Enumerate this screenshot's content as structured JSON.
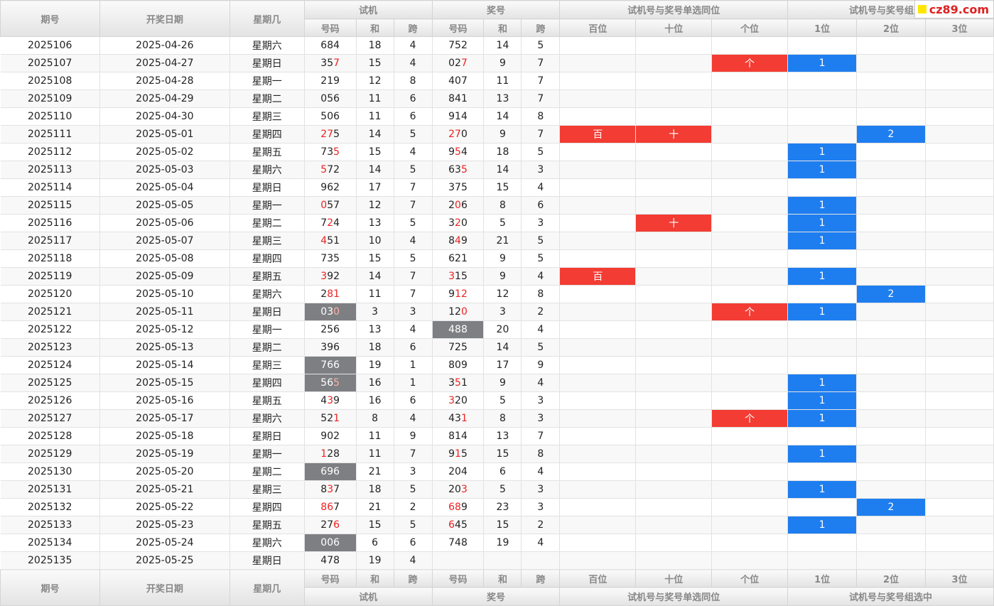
{
  "header": {
    "qihao": "期号",
    "date": "开奖日期",
    "week": "星期几",
    "shiji": "试机",
    "jianghao": "奖号",
    "same_pos": "试机号与奖号单选同位",
    "group": "试机号与奖号组选中",
    "haoma": "号码",
    "he": "和",
    "kua": "跨",
    "bai": "百位",
    "shi": "十位",
    "ge": "个位",
    "p1": "1位",
    "p2": "2位",
    "p3": "3位"
  },
  "logo": {
    "text": "cz89.com"
  },
  "colors": {
    "red_cell": "#f33c33",
    "blue_cell": "#1e7ef0",
    "gray_cell": "#7d7f82",
    "red_digit": "#ee2222"
  },
  "rows": [
    {
      "issue": "2025106",
      "date": "2025-04-26",
      "week": "星期六",
      "test": "684",
      "test_sum": "18",
      "test_span": "4",
      "win": "752",
      "win_sum": "14",
      "win_span": "5",
      "bai": "",
      "shi": "",
      "ge": "",
      "g1": "",
      "g2": "",
      "g3": "",
      "tr": [],
      "wr": [],
      "tg": false,
      "wg": false
    },
    {
      "issue": "2025107",
      "date": "2025-04-27",
      "week": "星期日",
      "test": "357",
      "test_sum": "15",
      "test_span": "4",
      "win": "027",
      "win_sum": "9",
      "win_span": "7",
      "bai": "",
      "shi": "",
      "ge": "个",
      "g1": "1",
      "g2": "",
      "g3": "",
      "tr": [
        2
      ],
      "wr": [
        2
      ],
      "tg": false,
      "wg": false
    },
    {
      "issue": "2025108",
      "date": "2025-04-28",
      "week": "星期一",
      "test": "219",
      "test_sum": "12",
      "test_span": "8",
      "win": "407",
      "win_sum": "11",
      "win_span": "7",
      "bai": "",
      "shi": "",
      "ge": "",
      "g1": "",
      "g2": "",
      "g3": "",
      "tr": [],
      "wr": [],
      "tg": false,
      "wg": false
    },
    {
      "issue": "2025109",
      "date": "2025-04-29",
      "week": "星期二",
      "test": "056",
      "test_sum": "11",
      "test_span": "6",
      "win": "841",
      "win_sum": "13",
      "win_span": "7",
      "bai": "",
      "shi": "",
      "ge": "",
      "g1": "",
      "g2": "",
      "g3": "",
      "tr": [],
      "wr": [],
      "tg": false,
      "wg": false
    },
    {
      "issue": "2025110",
      "date": "2025-04-30",
      "week": "星期三",
      "test": "506",
      "test_sum": "11",
      "test_span": "6",
      "win": "914",
      "win_sum": "14",
      "win_span": "8",
      "bai": "",
      "shi": "",
      "ge": "",
      "g1": "",
      "g2": "",
      "g3": "",
      "tr": [],
      "wr": [],
      "tg": false,
      "wg": false
    },
    {
      "issue": "2025111",
      "date": "2025-05-01",
      "week": "星期四",
      "test": "275",
      "test_sum": "14",
      "test_span": "5",
      "win": "270",
      "win_sum": "9",
      "win_span": "7",
      "bai": "百",
      "shi": "十",
      "ge": "",
      "g1": "",
      "g2": "2",
      "g3": "",
      "tr": [
        0,
        1
      ],
      "wr": [
        0,
        1
      ],
      "tg": false,
      "wg": false
    },
    {
      "issue": "2025112",
      "date": "2025-05-02",
      "week": "星期五",
      "test": "735",
      "test_sum": "15",
      "test_span": "4",
      "win": "954",
      "win_sum": "18",
      "win_span": "5",
      "bai": "",
      "shi": "",
      "ge": "",
      "g1": "1",
      "g2": "",
      "g3": "",
      "tr": [
        2
      ],
      "wr": [
        1
      ],
      "tg": false,
      "wg": false
    },
    {
      "issue": "2025113",
      "date": "2025-05-03",
      "week": "星期六",
      "test": "572",
      "test_sum": "14",
      "test_span": "5",
      "win": "635",
      "win_sum": "14",
      "win_span": "3",
      "bai": "",
      "shi": "",
      "ge": "",
      "g1": "1",
      "g2": "",
      "g3": "",
      "tr": [
        0
      ],
      "wr": [
        2
      ],
      "tg": false,
      "wg": false
    },
    {
      "issue": "2025114",
      "date": "2025-05-04",
      "week": "星期日",
      "test": "962",
      "test_sum": "17",
      "test_span": "7",
      "win": "375",
      "win_sum": "15",
      "win_span": "4",
      "bai": "",
      "shi": "",
      "ge": "",
      "g1": "",
      "g2": "",
      "g3": "",
      "tr": [],
      "wr": [],
      "tg": false,
      "wg": false
    },
    {
      "issue": "2025115",
      "date": "2025-05-05",
      "week": "星期一",
      "test": "057",
      "test_sum": "12",
      "test_span": "7",
      "win": "206",
      "win_sum": "8",
      "win_span": "6",
      "bai": "",
      "shi": "",
      "ge": "",
      "g1": "1",
      "g2": "",
      "g3": "",
      "tr": [
        0
      ],
      "wr": [
        1
      ],
      "tg": false,
      "wg": false
    },
    {
      "issue": "2025116",
      "date": "2025-05-06",
      "week": "星期二",
      "test": "724",
      "test_sum": "13",
      "test_span": "5",
      "win": "320",
      "win_sum": "5",
      "win_span": "3",
      "bai": "",
      "shi": "十",
      "ge": "",
      "g1": "1",
      "g2": "",
      "g3": "",
      "tr": [
        1
      ],
      "wr": [
        1
      ],
      "tg": false,
      "wg": false
    },
    {
      "issue": "2025117",
      "date": "2025-05-07",
      "week": "星期三",
      "test": "451",
      "test_sum": "10",
      "test_span": "4",
      "win": "849",
      "win_sum": "21",
      "win_span": "5",
      "bai": "",
      "shi": "",
      "ge": "",
      "g1": "1",
      "g2": "",
      "g3": "",
      "tr": [
        0
      ],
      "wr": [
        1
      ],
      "tg": false,
      "wg": false
    },
    {
      "issue": "2025118",
      "date": "2025-05-08",
      "week": "星期四",
      "test": "735",
      "test_sum": "15",
      "test_span": "5",
      "win": "621",
      "win_sum": "9",
      "win_span": "5",
      "bai": "",
      "shi": "",
      "ge": "",
      "g1": "",
      "g2": "",
      "g3": "",
      "tr": [],
      "wr": [],
      "tg": false,
      "wg": false
    },
    {
      "issue": "2025119",
      "date": "2025-05-09",
      "week": "星期五",
      "test": "392",
      "test_sum": "14",
      "test_span": "7",
      "win": "315",
      "win_sum": "9",
      "win_span": "4",
      "bai": "百",
      "shi": "",
      "ge": "",
      "g1": "1",
      "g2": "",
      "g3": "",
      "tr": [
        0
      ],
      "wr": [
        0
      ],
      "tg": false,
      "wg": false
    },
    {
      "issue": "2025120",
      "date": "2025-05-10",
      "week": "星期六",
      "test": "281",
      "test_sum": "11",
      "test_span": "7",
      "win": "912",
      "win_sum": "12",
      "win_span": "8",
      "bai": "",
      "shi": "",
      "ge": "",
      "g1": "",
      "g2": "2",
      "g3": "",
      "tr": [
        1,
        2
      ],
      "wr": [
        1,
        2
      ],
      "tg": false,
      "wg": false
    },
    {
      "issue": "2025121",
      "date": "2025-05-11",
      "week": "星期日",
      "test": "030",
      "test_sum": "3",
      "test_span": "3",
      "win": "120",
      "win_sum": "3",
      "win_span": "2",
      "bai": "",
      "shi": "",
      "ge": "个",
      "g1": "1",
      "g2": "",
      "g3": "",
      "tr": [
        2
      ],
      "wr": [
        2
      ],
      "tg": true,
      "wg": false
    },
    {
      "issue": "2025122",
      "date": "2025-05-12",
      "week": "星期一",
      "test": "256",
      "test_sum": "13",
      "test_span": "4",
      "win": "488",
      "win_sum": "20",
      "win_span": "4",
      "bai": "",
      "shi": "",
      "ge": "",
      "g1": "",
      "g2": "",
      "g3": "",
      "tr": [],
      "wr": [],
      "tg": false,
      "wg": true
    },
    {
      "issue": "2025123",
      "date": "2025-05-13",
      "week": "星期二",
      "test": "396",
      "test_sum": "18",
      "test_span": "6",
      "win": "725",
      "win_sum": "14",
      "win_span": "5",
      "bai": "",
      "shi": "",
      "ge": "",
      "g1": "",
      "g2": "",
      "g3": "",
      "tr": [],
      "wr": [],
      "tg": false,
      "wg": false
    },
    {
      "issue": "2025124",
      "date": "2025-05-14",
      "week": "星期三",
      "test": "766",
      "test_sum": "19",
      "test_span": "1",
      "win": "809",
      "win_sum": "17",
      "win_span": "9",
      "bai": "",
      "shi": "",
      "ge": "",
      "g1": "",
      "g2": "",
      "g3": "",
      "tr": [],
      "wr": [],
      "tg": true,
      "wg": false
    },
    {
      "issue": "2025125",
      "date": "2025-05-15",
      "week": "星期四",
      "test": "565",
      "test_sum": "16",
      "test_span": "1",
      "win": "351",
      "win_sum": "9",
      "win_span": "4",
      "bai": "",
      "shi": "",
      "ge": "",
      "g1": "1",
      "g2": "",
      "g3": "",
      "tr": [
        2
      ],
      "wr": [
        1
      ],
      "tg": true,
      "wg": false
    },
    {
      "issue": "2025126",
      "date": "2025-05-16",
      "week": "星期五",
      "test": "439",
      "test_sum": "16",
      "test_span": "6",
      "win": "320",
      "win_sum": "5",
      "win_span": "3",
      "bai": "",
      "shi": "",
      "ge": "",
      "g1": "1",
      "g2": "",
      "g3": "",
      "tr": [
        1
      ],
      "wr": [
        0
      ],
      "tg": false,
      "wg": false
    },
    {
      "issue": "2025127",
      "date": "2025-05-17",
      "week": "星期六",
      "test": "521",
      "test_sum": "8",
      "test_span": "4",
      "win": "431",
      "win_sum": "8",
      "win_span": "3",
      "bai": "",
      "shi": "",
      "ge": "个",
      "g1": "1",
      "g2": "",
      "g3": "",
      "tr": [
        2
      ],
      "wr": [
        2
      ],
      "tg": false,
      "wg": false
    },
    {
      "issue": "2025128",
      "date": "2025-05-18",
      "week": "星期日",
      "test": "902",
      "test_sum": "11",
      "test_span": "9",
      "win": "814",
      "win_sum": "13",
      "win_span": "7",
      "bai": "",
      "shi": "",
      "ge": "",
      "g1": "",
      "g2": "",
      "g3": "",
      "tr": [],
      "wr": [],
      "tg": false,
      "wg": false
    },
    {
      "issue": "2025129",
      "date": "2025-05-19",
      "week": "星期一",
      "test": "128",
      "test_sum": "11",
      "test_span": "7",
      "win": "915",
      "win_sum": "15",
      "win_span": "8",
      "bai": "",
      "shi": "",
      "ge": "",
      "g1": "1",
      "g2": "",
      "g3": "",
      "tr": [
        0
      ],
      "wr": [
        1
      ],
      "tg": false,
      "wg": false
    },
    {
      "issue": "2025130",
      "date": "2025-05-20",
      "week": "星期二",
      "test": "696",
      "test_sum": "21",
      "test_span": "3",
      "win": "204",
      "win_sum": "6",
      "win_span": "4",
      "bai": "",
      "shi": "",
      "ge": "",
      "g1": "",
      "g2": "",
      "g3": "",
      "tr": [],
      "wr": [],
      "tg": true,
      "wg": false
    },
    {
      "issue": "2025131",
      "date": "2025-05-21",
      "week": "星期三",
      "test": "837",
      "test_sum": "18",
      "test_span": "5",
      "win": "203",
      "win_sum": "5",
      "win_span": "3",
      "bai": "",
      "shi": "",
      "ge": "",
      "g1": "1",
      "g2": "",
      "g3": "",
      "tr": [
        1
      ],
      "wr": [
        2
      ],
      "tg": false,
      "wg": false
    },
    {
      "issue": "2025132",
      "date": "2025-05-22",
      "week": "星期四",
      "test": "867",
      "test_sum": "21",
      "test_span": "2",
      "win": "689",
      "win_sum": "23",
      "win_span": "3",
      "bai": "",
      "shi": "",
      "ge": "",
      "g1": "",
      "g2": "2",
      "g3": "",
      "tr": [
        0,
        1
      ],
      "wr": [
        0,
        1
      ],
      "tg": false,
      "wg": false
    },
    {
      "issue": "2025133",
      "date": "2025-05-23",
      "week": "星期五",
      "test": "276",
      "test_sum": "15",
      "test_span": "5",
      "win": "645",
      "win_sum": "15",
      "win_span": "2",
      "bai": "",
      "shi": "",
      "ge": "",
      "g1": "1",
      "g2": "",
      "g3": "",
      "tr": [
        2
      ],
      "wr": [
        0
      ],
      "tg": false,
      "wg": false
    },
    {
      "issue": "2025134",
      "date": "2025-05-24",
      "week": "星期六",
      "test": "006",
      "test_sum": "6",
      "test_span": "6",
      "win": "748",
      "win_sum": "19",
      "win_span": "4",
      "bai": "",
      "shi": "",
      "ge": "",
      "g1": "",
      "g2": "",
      "g3": "",
      "tr": [],
      "wr": [],
      "tg": true,
      "wg": false
    },
    {
      "issue": "2025135",
      "date": "2025-05-25",
      "week": "星期日",
      "test": "478",
      "test_sum": "19",
      "test_span": "4",
      "win": "",
      "win_sum": "",
      "win_span": "",
      "bai": "",
      "shi": "",
      "ge": "",
      "g1": "",
      "g2": "",
      "g3": "",
      "tr": [],
      "wr": [],
      "tg": false,
      "wg": false
    }
  ]
}
